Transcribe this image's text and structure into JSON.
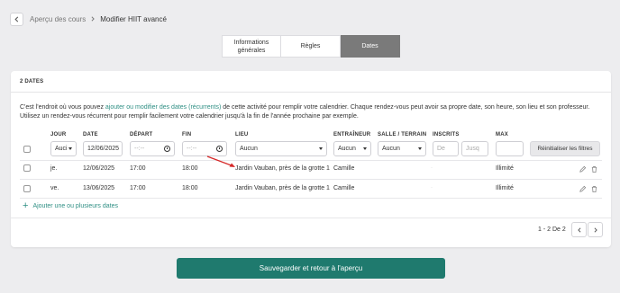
{
  "breadcrumb": {
    "parent": "Aperçu des cours",
    "current": "Modifier HIIT avancé"
  },
  "tabs": [
    {
      "label": "Informations générales",
      "active": false
    },
    {
      "label": "Règles",
      "active": false
    },
    {
      "label": "Dates",
      "active": true
    }
  ],
  "card": {
    "title": "2 DATES",
    "intro_before": "C'est l'endroit où vous pouvez ",
    "intro_link": "ajouter ou modifier des dates (récurrents)",
    "intro_after": " de cette activité pour remplir votre calendrier. Chaque rendez-vous peut avoir sa propre date, son heure, son lieu et son professeur. Utilisez un rendez-vous récurrent pour remplir facilement votre calendrier jusqu'à la fin de l'année prochaine par exemple."
  },
  "columns": {
    "day": "JOUR",
    "date": "DATE",
    "start": "DÉPART",
    "end": "FIN",
    "place": "LIEU",
    "coach": "ENTRAÎNEUR",
    "room": "SALLE / TERRAIN",
    "enrolled": "INSCRITS",
    "max": "MAX"
  },
  "filters": {
    "day": "Auci",
    "date": "12/06/2025",
    "start": "--:--",
    "end": "--:--",
    "place": "Aucun",
    "coach": "Aucun",
    "room": "Aucun",
    "enrolled_from": "De",
    "enrolled_to": "Jusq",
    "max": "",
    "reset_label": "Réinitialiser les filtres"
  },
  "rows": [
    {
      "day": "je.",
      "date": "12/06/2025",
      "start": "17:00",
      "end": "18:00",
      "place": "Jardin Vauban, près de la grotte 1",
      "coach": "Camille",
      "room": "",
      "enrolled": "·",
      "max": "Illimité"
    },
    {
      "day": "ve.",
      "date": "13/06/2025",
      "start": "17:00",
      "end": "18:00",
      "place": "Jardin Vauban, près de la grotte 1",
      "coach": "Camille",
      "room": "",
      "enrolled": "·",
      "max": "Illimité"
    }
  ],
  "add_dates_label": "Ajouter une ou plusieurs dates",
  "pagination": {
    "text": "1 - 2 De 2"
  },
  "save_label": "Sauvegarder et retour à l'aperçu",
  "colors": {
    "accent": "#1f7a6e",
    "link": "#2f8f84",
    "tab_active": "#7a7a7a",
    "annotation_arrow": "#d62828"
  }
}
